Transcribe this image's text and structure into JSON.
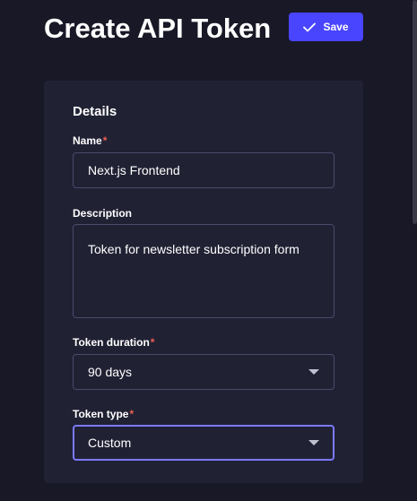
{
  "header": {
    "title": "Create API Token",
    "save_label": "Save"
  },
  "details": {
    "section_title": "Details",
    "name": {
      "label": "Name",
      "required_mark": "*",
      "value": "Next.js Frontend"
    },
    "description": {
      "label": "Description",
      "value": "Token for newsletter subscription form"
    },
    "token_duration": {
      "label": "Token duration",
      "required_mark": "*",
      "selected": "90 days"
    },
    "token_type": {
      "label": "Token type",
      "required_mark": "*",
      "selected": "Custom"
    }
  },
  "colors": {
    "background": "#181826",
    "card": "#212134",
    "accent": "#4945ff",
    "focus_border": "#7b79ff",
    "required": "#ee5e52",
    "input_border": "#4a4a6a"
  },
  "icons": {
    "save": "check-icon",
    "select": "caret-down-icon"
  }
}
